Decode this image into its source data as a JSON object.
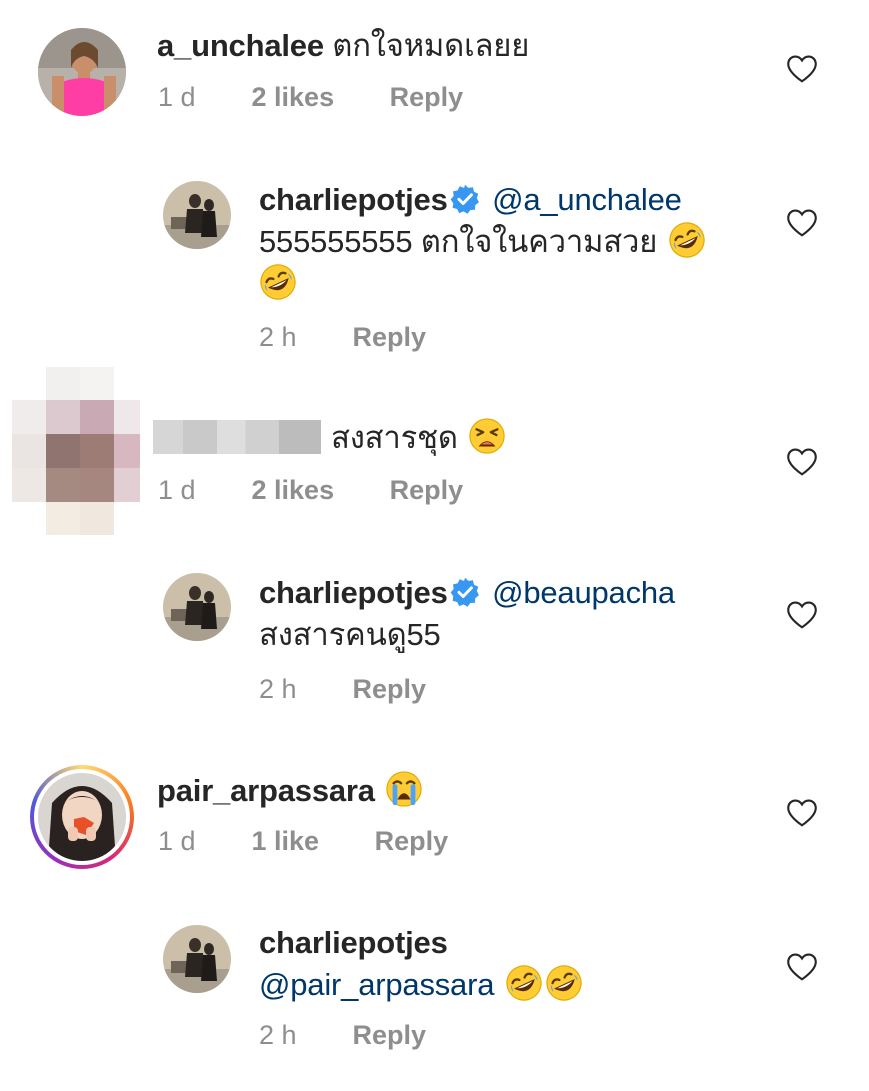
{
  "comments": [
    {
      "username": "a_unchalee",
      "text": "ตกใจหมดเลยย",
      "time": "1 d",
      "likes": "2 likes",
      "reply": "Reply"
    },
    {
      "username": "charliepotjes",
      "mention": "@a_unchalee",
      "text": "555555555 ตกใจในความสวย",
      "time": "2 h",
      "reply": "Reply"
    },
    {
      "username": "",
      "text": "สงสารชุด",
      "time": "1 d",
      "likes": "2 likes",
      "reply": "Reply"
    },
    {
      "username": "charliepotjes",
      "mention": "@beaupacha",
      "text": "สงสารคนดู55",
      "time": "2 h",
      "reply": "Reply"
    },
    {
      "username": "pair_arpassara",
      "text": "",
      "time": "1 d",
      "likes": "1 like",
      "reply": "Reply"
    },
    {
      "username": "charliepotjes",
      "mention": "@pair_arpassara",
      "text": "",
      "time": "2 h",
      "reply": "Reply"
    }
  ],
  "icons": {
    "like": "heart-outline-icon",
    "verified": "verified-badge-icon",
    "emoji_laugh": "rolling-on-floor-laughing-emoji",
    "emoji_weary": "weary-face-emoji",
    "emoji_cry": "loudly-crying-face-emoji"
  },
  "colors": {
    "text": "#262626",
    "secondary": "#8e8e8e",
    "mention": "#00376b",
    "verified": "#3897f0"
  }
}
